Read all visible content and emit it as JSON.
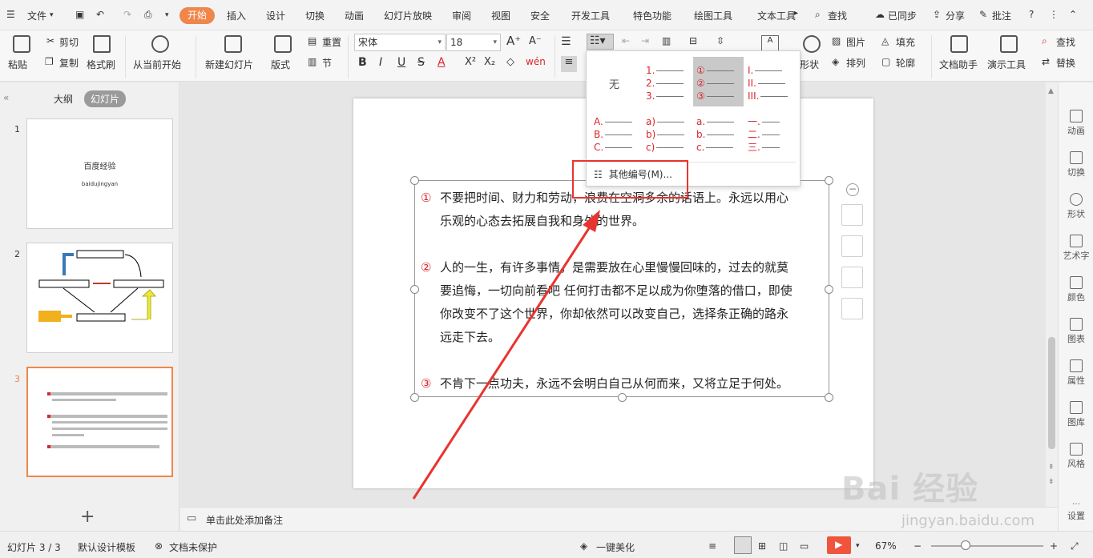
{
  "menubar": {
    "file": "文件",
    "tabs": [
      "开始",
      "插入",
      "设计",
      "切换",
      "动画",
      "幻灯片放映",
      "审阅",
      "视图",
      "安全",
      "开发工具",
      "特色功能",
      "绘图工具",
      "文本工具"
    ],
    "search": "查找",
    "sync": "已同步",
    "share": "分享",
    "comment": "批注"
  },
  "ribbon": {
    "paste": "粘贴",
    "cut": "剪切",
    "copy": "复制",
    "format_painter": "格式刷",
    "from_current": "从当前开始",
    "new_slide": "新建幻灯片",
    "layout": "版式",
    "reset": "重置",
    "section": "节",
    "font_name": "宋体",
    "font_size": "18",
    "shape": "形状",
    "picture": "图片",
    "arrange": "排列",
    "fill": "填充",
    "outline": "轮廓",
    "doc_helper": "文档助手",
    "present_tools": "演示工具",
    "find": "查找",
    "replace": "替换"
  },
  "leftpanel": {
    "outline_tab": "大纲",
    "slides_tab": "幻灯片",
    "slide1_title": "百度经验",
    "slide1_sub": "baidujingyan",
    "add": "+"
  },
  "slide": {
    "paras": [
      {
        "num": "①",
        "lines": [
          "不要把时间、财力和劳动，浪费在空洞多余的话语上。永远以用心",
          "乐观的心态去拓展自我和身外的世界。"
        ]
      },
      {
        "num": "②",
        "lines": [
          "人的一生，有许多事情，是需要放在心里慢慢回味的，过去的就莫",
          "要追悔，一切向前看吧 任何打击都不足以成为你堕落的借口，即使",
          "你改变不了这个世界，你却依然可以改变自己，选择条正确的路永",
          "远走下去。"
        ]
      },
      {
        "num": "③",
        "lines": [
          "不肯下一点功夫，永远不会明白自己从何而来，又将立足于何处。"
        ]
      }
    ]
  },
  "popup": {
    "none": "无",
    "more_numbering": "其他编号(M)...",
    "row1": [
      [
        "1.",
        "2.",
        "3."
      ],
      [
        "①",
        "②",
        "③"
      ],
      [
        "I.",
        "II.",
        "III."
      ]
    ],
    "row2": [
      [
        "A.",
        "B.",
        "C."
      ],
      [
        "a)",
        "b)",
        "c)"
      ],
      [
        "a.",
        "b.",
        "c."
      ],
      [
        "一.",
        "二.",
        "三."
      ]
    ]
  },
  "rightbar": {
    "items": [
      "动画",
      "切换",
      "形状",
      "艺术字",
      "颜色",
      "图表",
      "属性",
      "图库",
      "风格",
      "设置"
    ]
  },
  "notes": {
    "placeholder": "单击此处添加备注"
  },
  "statusbar": {
    "slide_count": "幻灯片 3 / 3",
    "template": "默认设计模板",
    "protect": "文档未保护",
    "beautify": "一键美化",
    "zoom": "67%"
  },
  "watermark": {
    "brand": "Bai 经验",
    "url": "jingyan.baidu.com"
  },
  "colors": {
    "accent": "#f0864a",
    "bullet_red": "#d9262c",
    "annotation_red": "#e8342f"
  }
}
